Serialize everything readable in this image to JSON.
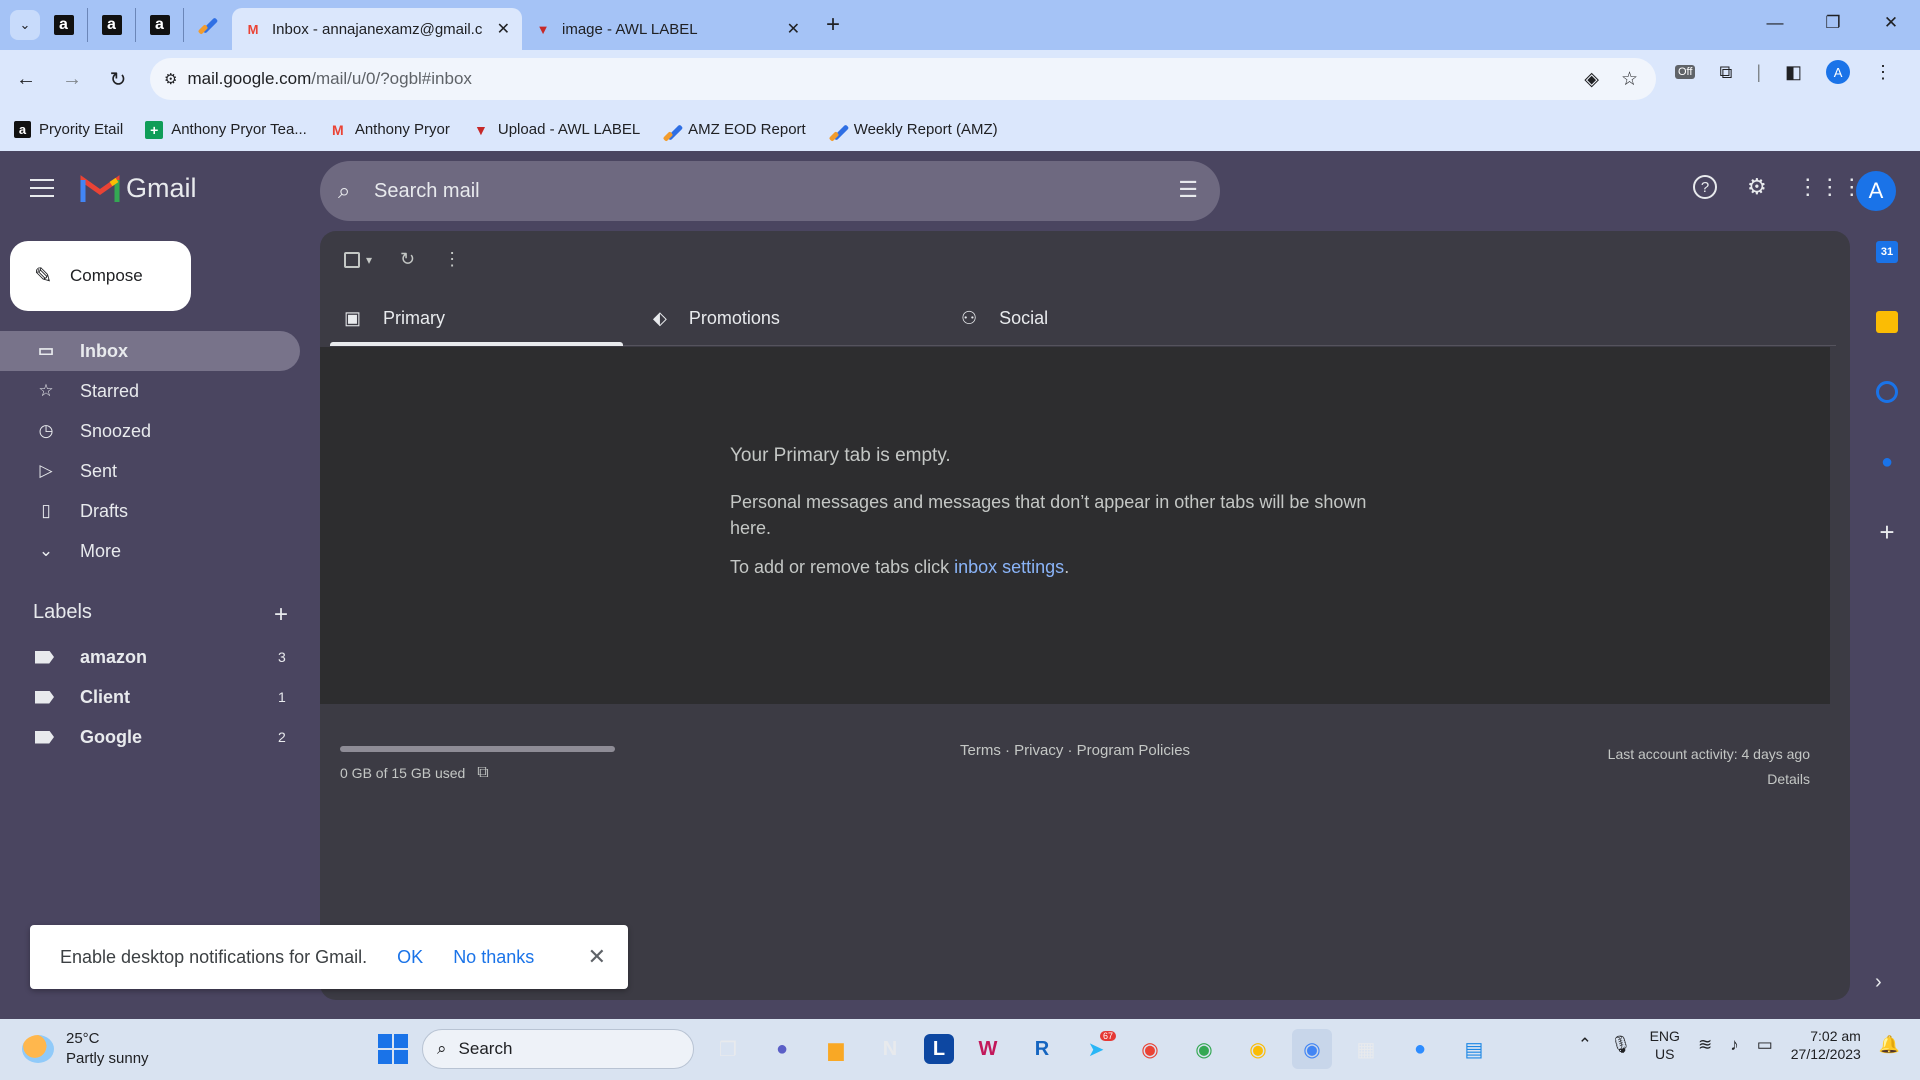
{
  "browser": {
    "tabs": [
      {
        "title": "Inbox - annajanexamz@gmail.c",
        "active": true
      },
      {
        "title": "image - AWL LABEL",
        "active": false
      }
    ],
    "pinned_icons": [
      "amazon-icon",
      "amazon-icon",
      "amazon-icon",
      "pen-app-icon"
    ],
    "url_host": "mail.google.com",
    "url_path": "/mail/u/0/?ogbl#inbox",
    "extension_badge": "Off",
    "profile_initial": "A",
    "bookmarks": [
      {
        "label": "Pryority Etail",
        "icon": "amazon-icon"
      },
      {
        "label": "Anthony Pryor Tea...",
        "icon": "sheets-icon"
      },
      {
        "label": "Anthony Pryor",
        "icon": "gmail-icon"
      },
      {
        "label": "Upload - AWL LABEL",
        "icon": "awl-icon"
      },
      {
        "label": "AMZ EOD Report",
        "icon": "pen-app-icon"
      },
      {
        "label": "Weekly Report (AMZ)",
        "icon": "pen-app-icon"
      }
    ]
  },
  "gmail": {
    "brand": "Gmail",
    "search_placeholder": "Search mail",
    "account_initial": "A",
    "compose": "Compose",
    "nav": [
      {
        "label": "Inbox",
        "icon": "inbox-icon",
        "active": true
      },
      {
        "label": "Starred",
        "icon": "star-icon"
      },
      {
        "label": "Snoozed",
        "icon": "clock-icon"
      },
      {
        "label": "Sent",
        "icon": "send-icon"
      },
      {
        "label": "Drafts",
        "icon": "file-icon"
      },
      {
        "label": "More",
        "icon": "chevron-down-icon"
      }
    ],
    "labels_title": "Labels",
    "labels": [
      {
        "name": "amazon",
        "count": "3"
      },
      {
        "name": "Client",
        "count": "1"
      },
      {
        "name": "Google",
        "count": "2"
      }
    ],
    "categories": [
      {
        "label": "Primary",
        "icon": "inbox-icon",
        "active": true
      },
      {
        "label": "Promotions",
        "icon": "tag-icon"
      },
      {
        "label": "Social",
        "icon": "people-icon"
      }
    ],
    "empty": {
      "title": "Your Primary tab is empty.",
      "message": "Personal messages and messages that don’t appear in other tabs will be shown here.",
      "settings_prefix": "To add or remove tabs click ",
      "settings_link": "inbox settings",
      "settings_suffix": "."
    },
    "footer": {
      "storage": "0 GB of 15 GB used",
      "storage_fraction": 0.0,
      "links": "Terms · Privacy · Program Policies",
      "activity": "Last account activity: 4 days ago",
      "details": "Details"
    },
    "notification": {
      "text": "Enable desktop notifications for Gmail.",
      "ok": "OK",
      "no_thanks": "No thanks"
    },
    "side_panel": [
      "calendar-icon",
      "keep-icon",
      "tasks-icon",
      "contacts-icon",
      "plus-icon"
    ]
  },
  "taskbar": {
    "temperature": "25°C",
    "weather": "Partly sunny",
    "search": "Search",
    "telegram_badge": "67",
    "lang_top": "ENG",
    "lang_bottom": "US",
    "time": "7:02 am",
    "date": "27/12/2023"
  }
}
